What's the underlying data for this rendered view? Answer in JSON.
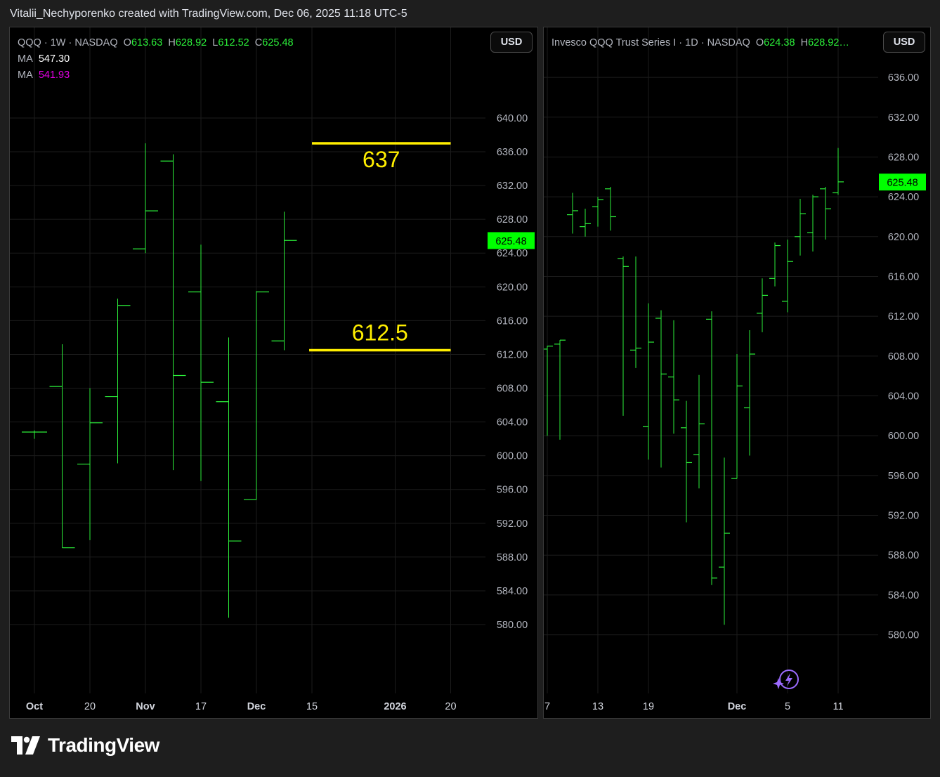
{
  "header": {
    "text": "Vitalii_Nechyporenko created with TradingView.com, Dec 06, 2025 11:18 UTC-5"
  },
  "brand": {
    "name": "TradingView"
  },
  "colors": {
    "bar": "#2cf03a",
    "price_tag": "#00ff00",
    "annotation": "#ffee00",
    "grid": "#1c1c1c",
    "ma1": "#ffffff",
    "ma2": "#e600e6"
  },
  "left": {
    "currency": "USD",
    "legend": {
      "symbol": "QQQ · 1W · NASDAQ",
      "o_label": "O",
      "o": "613.63",
      "h_label": "H",
      "h": "628.92",
      "l_label": "L",
      "l": "612.52",
      "c_label": "C",
      "c": "625.48",
      "ma1_label": "MA",
      "ma1": "547.30",
      "ma2_label": "MA",
      "ma2": "541.93"
    },
    "price_tag": "625.48"
  },
  "right": {
    "currency": "USD",
    "legend": {
      "title": "Invesco QQQ Trust Series I · 1D · NASDAQ",
      "o_label": "O",
      "o": "624.38",
      "h_label": "H",
      "h": "628.92…"
    },
    "price_tag": "625.48"
  },
  "chart_data": [
    {
      "type": "ohlc",
      "interval": "1W",
      "symbol": "QQQ",
      "ylim": [
        576.5,
        643.0
      ],
      "yticks": [
        "640.00",
        "636.00",
        "632.00",
        "628.00",
        "624.00",
        "620.00",
        "616.00",
        "612.00",
        "608.00",
        "604.00",
        "600.00",
        "596.00",
        "592.00",
        "588.00",
        "584.00",
        "580.00"
      ],
      "xticks": [
        {
          "label": "Oct",
          "pos": 0.0
        },
        {
          "label": "20",
          "pos": 2.0
        },
        {
          "label": "Nov",
          "pos": 4.0
        },
        {
          "label": "17",
          "pos": 6.0
        },
        {
          "label": "Dec",
          "pos": 8.0
        },
        {
          "label": "15",
          "pos": 10.0
        },
        {
          "label": "2026",
          "pos": 13.0
        },
        {
          "label": "20",
          "pos": 15.0
        }
      ],
      "bars": [
        {
          "o": 602.8,
          "h": 603.0,
          "l": 602.0,
          "c": 602.8
        },
        {
          "o": 608.2,
          "h": 613.2,
          "l": 589.1,
          "c": 589.1
        },
        {
          "o": 599.0,
          "h": 608.0,
          "l": 590.0,
          "c": 603.9
        },
        {
          "o": 607.0,
          "h": 618.6,
          "l": 599.1,
          "c": 617.8
        },
        {
          "o": 624.5,
          "h": 637.0,
          "l": 624.0,
          "c": 629.0
        },
        {
          "o": 634.9,
          "h": 635.7,
          "l": 598.3,
          "c": 609.5
        },
        {
          "o": 619.4,
          "h": 625.0,
          "l": 597.0,
          "c": 608.7
        },
        {
          "o": 606.4,
          "h": 614.0,
          "l": 580.8,
          "c": 589.9
        },
        {
          "o": 594.8,
          "h": 619.5,
          "l": 594.8,
          "c": 619.4
        },
        {
          "o": 613.6,
          "h": 628.9,
          "l": 612.5,
          "c": 625.5
        }
      ],
      "annotations": [
        {
          "label": "637",
          "value": 637.0,
          "x_from": 10.0,
          "x_to": 15.0
        },
        {
          "label": "612.5",
          "value": 612.5,
          "x_from": 9.9,
          "x_to": 15.0
        }
      ],
      "last_price": 625.48
    },
    {
      "type": "ohlc",
      "interval": "1D",
      "symbol": "QQQ",
      "ylim": [
        576.4,
        640.0
      ],
      "yticks": [
        "636.00",
        "632.00",
        "628.00",
        "624.00",
        "620.00",
        "616.00",
        "612.00",
        "608.00",
        "604.00",
        "600.00",
        "596.00",
        "592.00",
        "588.00",
        "584.00",
        "580.00"
      ],
      "xticks": [
        {
          "label": "7",
          "pos": 0.0
        },
        {
          "label": "13",
          "pos": 4.0
        },
        {
          "label": "19",
          "pos": 8.0
        },
        {
          "label": "Dec",
          "pos": 15.0
        },
        {
          "label": "5",
          "pos": 19.0
        },
        {
          "label": "11",
          "pos": 23.0
        }
      ],
      "bars": [
        {
          "o": 608.7,
          "h": 609.0,
          "l": 600.0,
          "c": 609.0
        },
        {
          "o": 609.2,
          "h": 609.6,
          "l": 599.6,
          "c": 609.6
        },
        {
          "o": 622.2,
          "h": 624.4,
          "l": 620.3,
          "c": 622.6
        },
        {
          "o": 621.0,
          "h": 622.8,
          "l": 620.0,
          "c": 621.3
        },
        {
          "o": 623.0,
          "h": 624.0,
          "l": 621.0,
          "c": 623.7
        },
        {
          "o": 624.8,
          "h": 625.0,
          "l": 620.6,
          "c": 622.0
        },
        {
          "o": 617.8,
          "h": 618.0,
          "l": 602.0,
          "c": 617.0
        },
        {
          "o": 608.6,
          "h": 618.0,
          "l": 606.8,
          "c": 608.8
        },
        {
          "o": 600.9,
          "h": 613.3,
          "l": 597.6,
          "c": 609.4
        },
        {
          "o": 611.8,
          "h": 612.6,
          "l": 596.8,
          "c": 606.2
        },
        {
          "o": 605.9,
          "h": 611.6,
          "l": 600.2,
          "c": 603.6
        },
        {
          "o": 600.8,
          "h": 603.5,
          "l": 591.3,
          "c": 597.3
        },
        {
          "o": 598.1,
          "h": 606.1,
          "l": 594.7,
          "c": 601.2
        },
        {
          "o": 611.7,
          "h": 612.5,
          "l": 585.0,
          "c": 585.7
        },
        {
          "o": 586.8,
          "h": 597.8,
          "l": 581.0,
          "c": 590.2
        },
        {
          "o": 595.7,
          "h": 608.2,
          "l": 595.7,
          "c": 605.0
        },
        {
          "o": 602.8,
          "h": 610.6,
          "l": 598.0,
          "c": 608.2
        },
        {
          "o": 612.3,
          "h": 615.8,
          "l": 610.4,
          "c": 614.1
        },
        {
          "o": 615.8,
          "h": 619.4,
          "l": 615.0,
          "c": 619.1
        },
        {
          "o": 613.5,
          "h": 619.7,
          "l": 612.4,
          "c": 617.5
        },
        {
          "o": 620.0,
          "h": 623.8,
          "l": 618.1,
          "c": 622.3
        },
        {
          "o": 620.4,
          "h": 624.2,
          "l": 618.5,
          "c": 624.0
        },
        {
          "o": 624.8,
          "h": 625.0,
          "l": 619.7,
          "c": 622.8
        },
        {
          "o": 624.4,
          "h": 628.9,
          "l": 624.2,
          "c": 625.5
        }
      ],
      "last_price": 625.48
    }
  ]
}
